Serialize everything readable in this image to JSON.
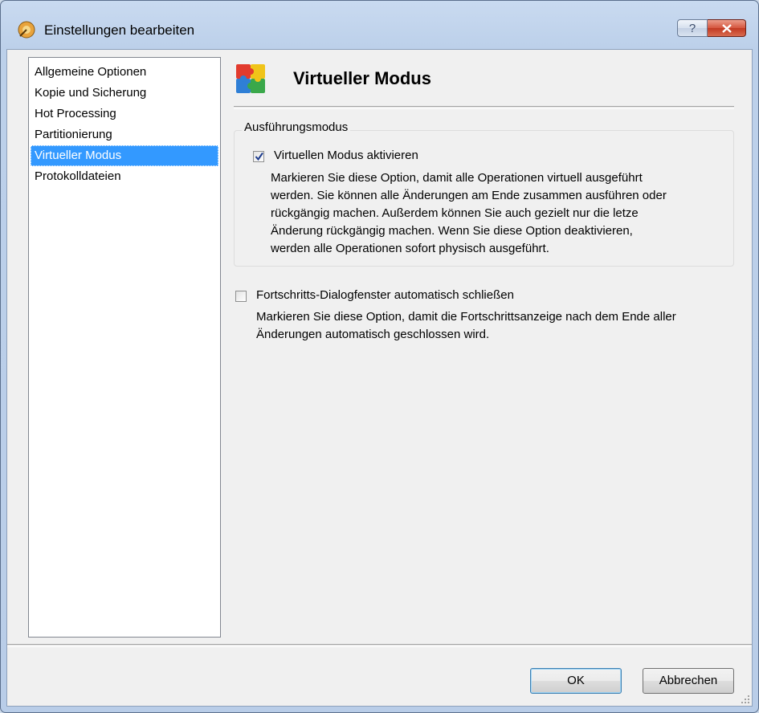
{
  "window": {
    "title": "Einstellungen bearbeiten",
    "help_label": "?"
  },
  "sidebar": {
    "items": [
      {
        "label": "Allgemeine Optionen"
      },
      {
        "label": "Kopie und Sicherung"
      },
      {
        "label": "Hot Processing"
      },
      {
        "label": "Partitionierung"
      },
      {
        "label": "Virtueller Modus"
      },
      {
        "label": "Protokolldateien"
      }
    ],
    "selected_index": 4
  },
  "page": {
    "title": "Virtueller Modus",
    "group_label": "Ausführungsmodus",
    "option1": {
      "label": "Virtuellen Modus aktivieren",
      "checked": true,
      "description_lines": [
        "Markieren Sie diese Option, damit alle Operationen virtuell ausgeführt",
        "werden. Sie können alle Änderungen am Ende zusammen ausführen oder",
        "rückgängig machen. Außerdem können Sie auch gezielt nur die letze",
        "Änderung rückgängig machen. Wenn Sie diese Option deaktivieren,",
        "werden alle Operationen sofort physisch ausgeführt."
      ]
    },
    "option2": {
      "label": "Fortschritts-Dialogfenster automatisch schließen",
      "checked": false,
      "description_lines": [
        "Markieren Sie diese Option, damit die Fortschrittsanzeige nach dem Ende aller",
        "Änderungen automatisch geschlossen wird."
      ]
    }
  },
  "buttons": {
    "ok": "OK",
    "cancel": "Abbrechen"
  },
  "colors": {
    "selection": "#3399ff",
    "close_button": "#c7452c"
  }
}
